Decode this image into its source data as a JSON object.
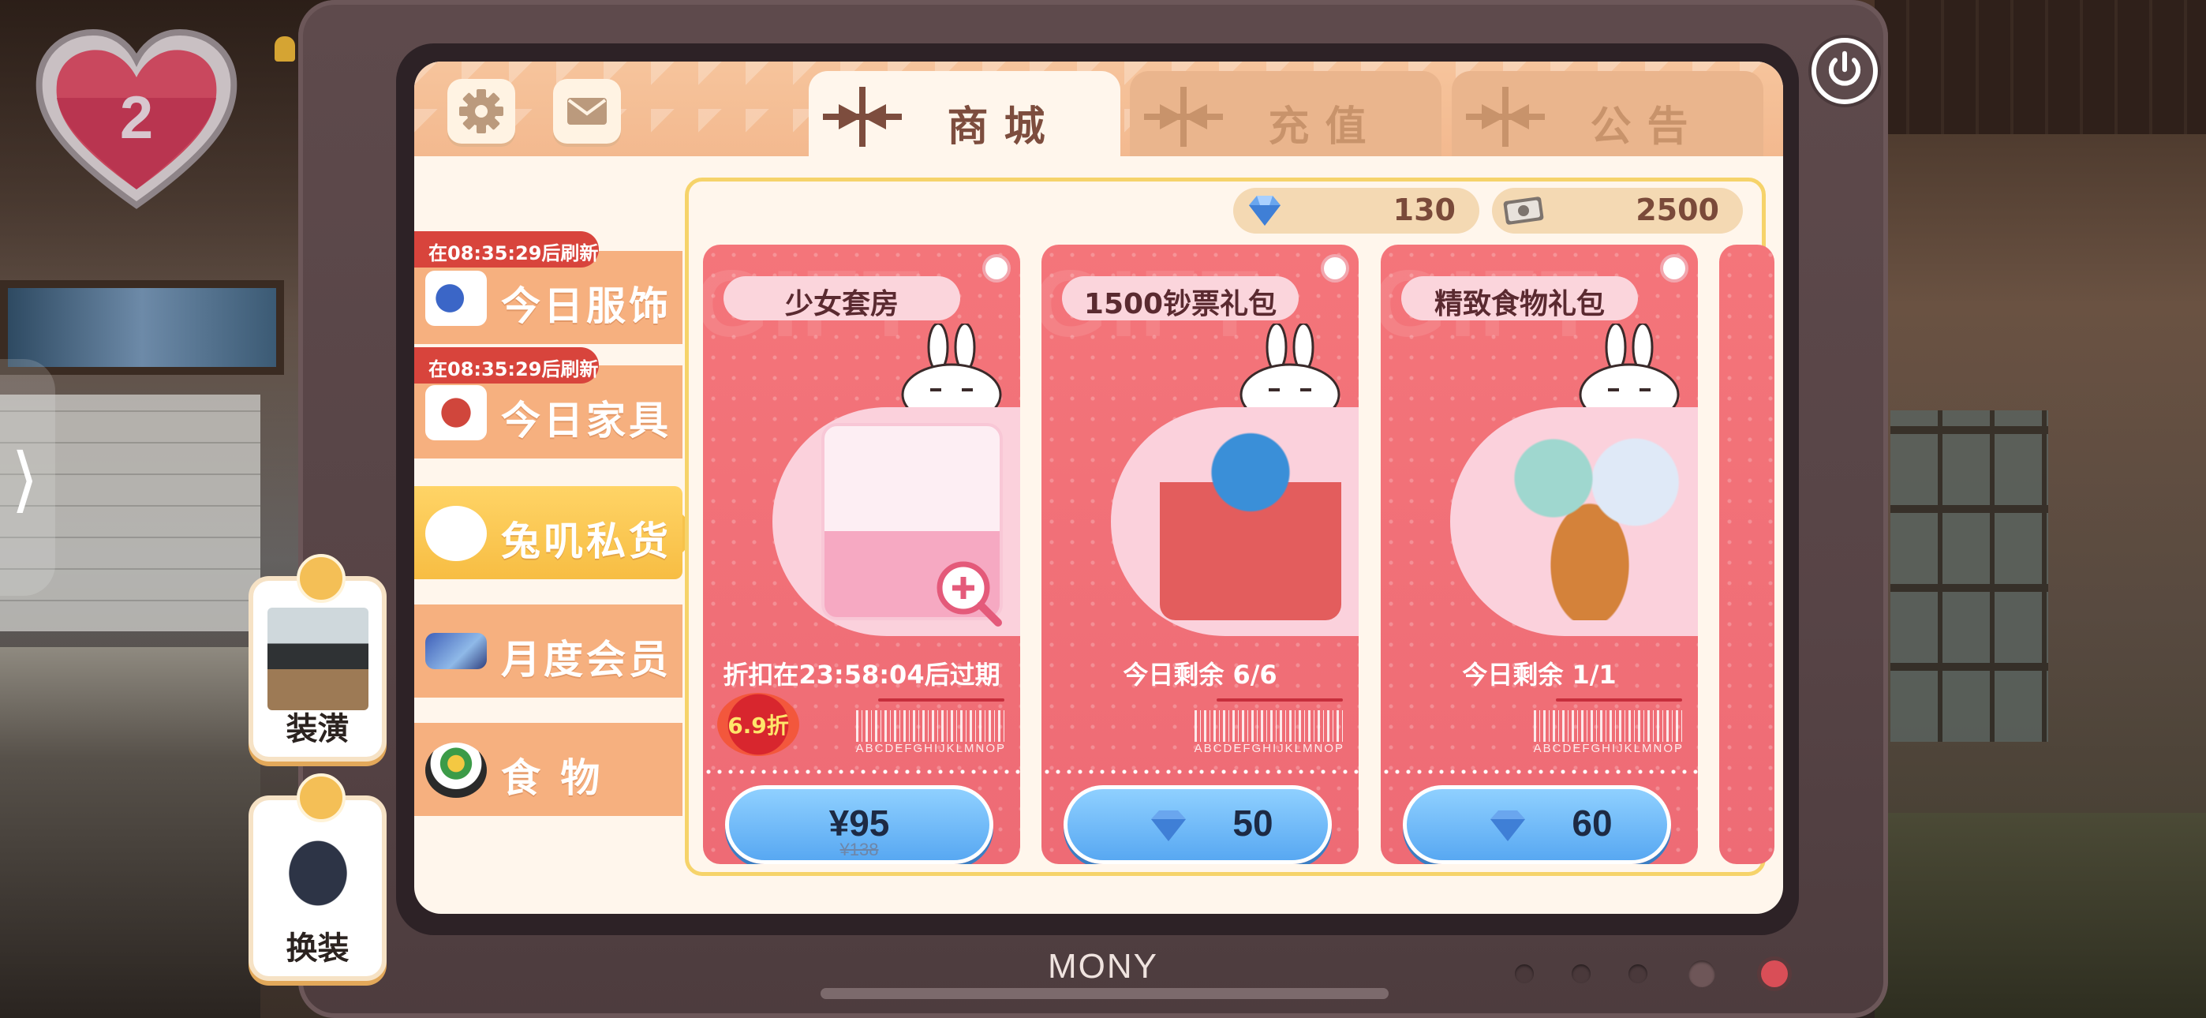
{
  "hud": {
    "lives": "2"
  },
  "side_buttons": [
    {
      "label": "装潢"
    },
    {
      "label": "换装"
    }
  ],
  "tv": {
    "brand": "MONY"
  },
  "tabs": [
    {
      "label": "商城",
      "active": true
    },
    {
      "label": "充值",
      "active": false
    },
    {
      "label": "公告",
      "active": false
    }
  ],
  "sidebar": {
    "items": [
      {
        "label": "今日服饰",
        "refresh": "在08:35:29后刷新",
        "icon": "clothes-icon"
      },
      {
        "label": "今日家具",
        "refresh": "在08:35:29后刷新",
        "icon": "furniture-icon"
      },
      {
        "label": "兔叽私货",
        "active": true,
        "icon": "bunny-icon"
      },
      {
        "label": "月度会员",
        "icon": "card-icon"
      },
      {
        "label": "食  物",
        "icon": "food-bowl-icon"
      }
    ]
  },
  "currency": {
    "gems": "130",
    "cash": "2500"
  },
  "products": [
    {
      "title": "少女套房",
      "info": "折扣在23:58:04后过期",
      "discount": "6.9折",
      "price": "¥95",
      "old_price": "¥138",
      "barcode_text": "ABCDEFGHIJKLMNOP"
    },
    {
      "title": "1500钞票礼包",
      "info": "今日剩余 6/6",
      "price": "50",
      "barcode_text": "ABCDEFGHIJKLMNOP"
    },
    {
      "title": "精致食物礼包",
      "info": "今日剩余 1/1",
      "price": "60",
      "barcode_text": "ABCDEFGHIJKLMNOP"
    }
  ],
  "card_bg_text": "GIFT",
  "colors": {
    "card": "#ee6b75",
    "accent_yellow": "#f7bd43",
    "button_blue": "#58a8f2",
    "tab_active_text": "#7d4d3e"
  }
}
